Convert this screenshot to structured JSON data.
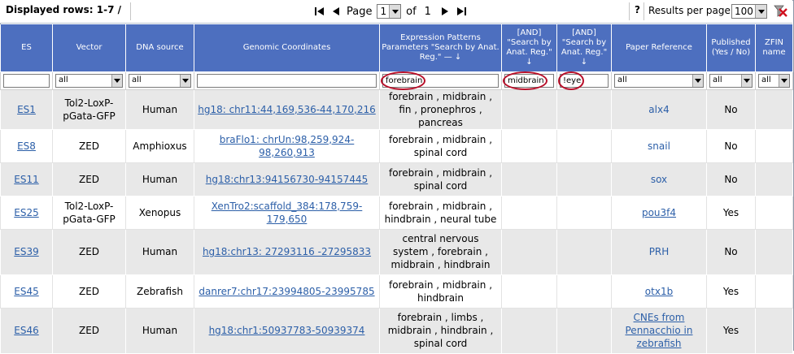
{
  "toolbar": {
    "rows_label": "Displayed rows: 1-7 /",
    "page_label": "Page",
    "page_value": "1",
    "of_label": "of",
    "total_pages": "1",
    "help_label": "?",
    "rpp_label": "Results per page",
    "rpp_value": "100"
  },
  "headers": {
    "es": "ES",
    "vector": "Vector",
    "dna": "DNA source",
    "coords": "Genomic Coordinates",
    "expr": "Expression Patterns Parameters \"Search by Anat. Reg.\" — ↓",
    "and1": "[AND] \"Search by Anat. Reg.\" ↓",
    "and2": "[AND] \"Search by Anat. Reg.\" ↓",
    "paper": "Paper Reference",
    "published": "Published (Yes / No)",
    "zfin": "ZFIN name"
  },
  "filters": {
    "es": "",
    "vector": "all",
    "dna": "all",
    "coords": "",
    "expr": "forebrain",
    "and1": "midbrain",
    "and2": "!eye",
    "paper": "all",
    "published": "all",
    "zfin": "all"
  },
  "rows": [
    {
      "es": "ES1",
      "vector": "Tol2-LoxP-pGata-GFP",
      "dna": "Human",
      "coords": "hg18: chr11:44,169,536-44,170,216",
      "expr": "forebrain , midbrain , fin , pronephros , pancreas",
      "paper": "alx4",
      "published": "No"
    },
    {
      "es": "ES8",
      "vector": "ZED",
      "dna": "Amphioxus",
      "coords": "braFlo1: chrUn:98,259,924-98,260,913",
      "expr": "forebrain , midbrain , spinal cord",
      "paper": "snail",
      "published": "No"
    },
    {
      "es": "ES11",
      "vector": "ZED",
      "dna": "Human",
      "coords": "hg18:chr13:94156730-94157445",
      "expr": "forebrain , midbrain , spinal cord",
      "paper": "sox",
      "published": "No"
    },
    {
      "es": "ES25",
      "vector": "Tol2-LoxP-pGata-GFP",
      "dna": "Xenopus",
      "coords": "XenTro2:scaffold_384:178,759-179,650",
      "expr": "forebrain , midbrain , hindbrain , neural tube",
      "paper": "pou3f4",
      "published": "Yes"
    },
    {
      "es": "ES39",
      "vector": "ZED",
      "dna": "Human",
      "coords": "hg18:chr13: 27293116 -27295833",
      "expr": "central nervous system , forebrain , midbrain , hindbrain",
      "paper": "PRH",
      "published": "No"
    },
    {
      "es": "ES45",
      "vector": "ZED",
      "dna": "Zebrafish",
      "coords": "danrer7:chr17:23994805-23995785",
      "expr": "forebrain , midbrain , hindbrain",
      "paper": "otx1b",
      "published": "Yes"
    },
    {
      "es": "ES46",
      "vector": "ZED",
      "dna": "Human",
      "coords": "hg18:chr1:50937783-50939374",
      "expr": "forebrain , limbs , midbrain , hindbrain , spinal cord",
      "paper": "CNEs from Pennacchio in zebrafish",
      "published": "Yes"
    }
  ],
  "colors": {
    "header_bg": "#4d6fbf",
    "link": "#2c5fa8",
    "highlight": "#b8102a",
    "row_alt": "#e8e8e8"
  },
  "icons": [
    "first-page-icon",
    "prev-page-icon",
    "next-page-icon",
    "last-page-icon",
    "clear-filters-icon",
    "dropdown-arrow-icon"
  ]
}
